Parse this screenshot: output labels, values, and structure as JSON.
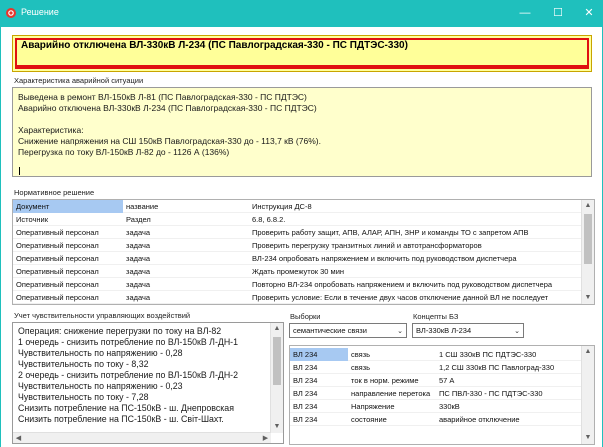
{
  "window": {
    "title": "Решение",
    "minimize_glyph": "—",
    "maximize_glyph": "☐",
    "close_glyph": "✕",
    "accent": "#1fc0bd"
  },
  "alarm": {
    "text": "Аварийно отключена ВЛ-330кВ Л-234 (ПС Павлоградская-330 - ПС ПДТЭС-330)",
    "bg": "#ffff99",
    "border": "#e01010"
  },
  "characteristic": {
    "label": "Характеристика аварийной ситуации",
    "lines": [
      "Выведена в ремонт ВЛ-150кВ Л-81 (ПС Павлоградская-330 - ПС ПДТЭС)",
      "Аварийно отключена ВЛ-330кВ Л-234 (ПС Павлоградская-330 - ПС ПДТЭС)",
      "",
      "Характеристика:",
      "Снижение напряжения на СШ 150кВ Павлоградская-330 до - 113,7 кВ (76%).",
      "Перегрузка по току ВЛ-150кВ Л-82 до - 1126 А (136%)"
    ]
  },
  "normative": {
    "label": "Нормативное решение",
    "rows": [
      [
        "Документ",
        "название",
        "Инструкция ДС-8"
      ],
      [
        "Источник",
        "Раздел",
        "6.8, 6.8.2."
      ],
      [
        "Оперативный персонал",
        "задача",
        "Проверить работу защит,  АПВ, АЛАР, АПН, ЗНР и команды ТО с запретом АПВ"
      ],
      [
        "Оперативный персонал",
        "задача",
        "Проверить перегрузку транзитных линий и автотрансформаторов"
      ],
      [
        "Оперативный персонал",
        "задача",
        "ВЛ-234 опробовать напряжением и включить под руководством диспетчера"
      ],
      [
        "Оперативный персонал",
        "задача",
        "Ждать промежуток 30 мин"
      ],
      [
        "Оперативный персонал",
        "задача",
        "Повторно ВЛ-234 опробовать напряжением и включить под руководством диспетчера"
      ],
      [
        "Оперативный персонал",
        "задача",
        "Проверить условие: Если в течение двух часов отключение данной ВЛ не последует"
      ]
    ],
    "scroll_up": "▲",
    "scroll_down": "▼"
  },
  "sensitivity": {
    "label": "Учет чувствительности управляющих воздействий",
    "lines": [
      "Операция: снижение перегрузки по току на ВЛ-82",
      "1 очередь - снизить потребление по ВЛ-150кВ Л-ДН-1",
      "Чувствительность по напряжению - 0,28",
      "Чувствительность по току - 8,32",
      "2 очередь - снизить потребление по ВЛ-150кВ Л-ДН-2",
      "Чувствительность по напряжению - 0,23",
      "Чувствительность по току - 7,28",
      "Снизить потребление на ПС-150кВ - ш. Днепровская",
      "Снизить потребление на ПС-150кВ - ш. Світ-Шахт."
    ],
    "scroll_left": "◀",
    "scroll_right": "▶",
    "scroll_up": "▲",
    "scroll_down": "▼"
  },
  "filters": {
    "selections_label": "Выборки",
    "selections_value": "семантические связи",
    "concepts_label": "Концепты БЗ",
    "concepts_value": "ВЛ-330кВ Л-234",
    "dropdown_glyph": "⌄"
  },
  "relations": {
    "rows": [
      [
        "ВЛ 234",
        "связь",
        "1 СШ 330кВ ПС ПДТЭС-330"
      ],
      [
        "ВЛ 234",
        "связь",
        "1,2 СШ 330кВ ПС Павлоград-330"
      ],
      [
        "ВЛ 234",
        "ток в норм. режиме",
        "57 А"
      ],
      [
        "ВЛ 234",
        "направление перетока",
        "ПС ПВЛ-330 - ПС ПДТЭС-330"
      ],
      [
        "ВЛ 234",
        "Напряжение",
        "330кВ"
      ],
      [
        "ВЛ 234",
        "состояние",
        "аварийное отключение"
      ]
    ],
    "scroll_up": "▲",
    "scroll_down": "▼"
  }
}
